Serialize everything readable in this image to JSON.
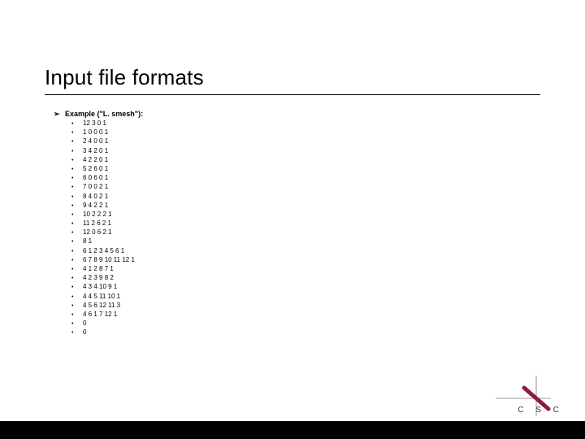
{
  "title": "Input file formats",
  "example_label": "Example (\"L. smesh\"):",
  "lines": [
    "12 3 0 1",
    "1 0 0 0 1",
    "2 4 0 0 1",
    "3 4 2 0 1",
    "4 2 2 0 1",
    "5 2 6 0 1",
    "6 0 6 0 1",
    "7 0 0 2 1",
    "8 4 0 2 1",
    "9 4 2 2 1",
    "10 2 2 2 1",
    "11 2 6 2 1",
    "12 0 6 2 1",
    "8 1",
    "6 1 2 3 4 5 6 1",
    "6 7 8 9 10 11 12 1",
    "4 1 2 8 7 1",
    "4 2 3 9 8 2",
    "4 3 4 10 9 1",
    "4 4 5 11 10 1",
    "4 5 6 12 11 3",
    "4 6 1 7 12 1",
    "0",
    "0"
  ],
  "logo_text": "C S C"
}
